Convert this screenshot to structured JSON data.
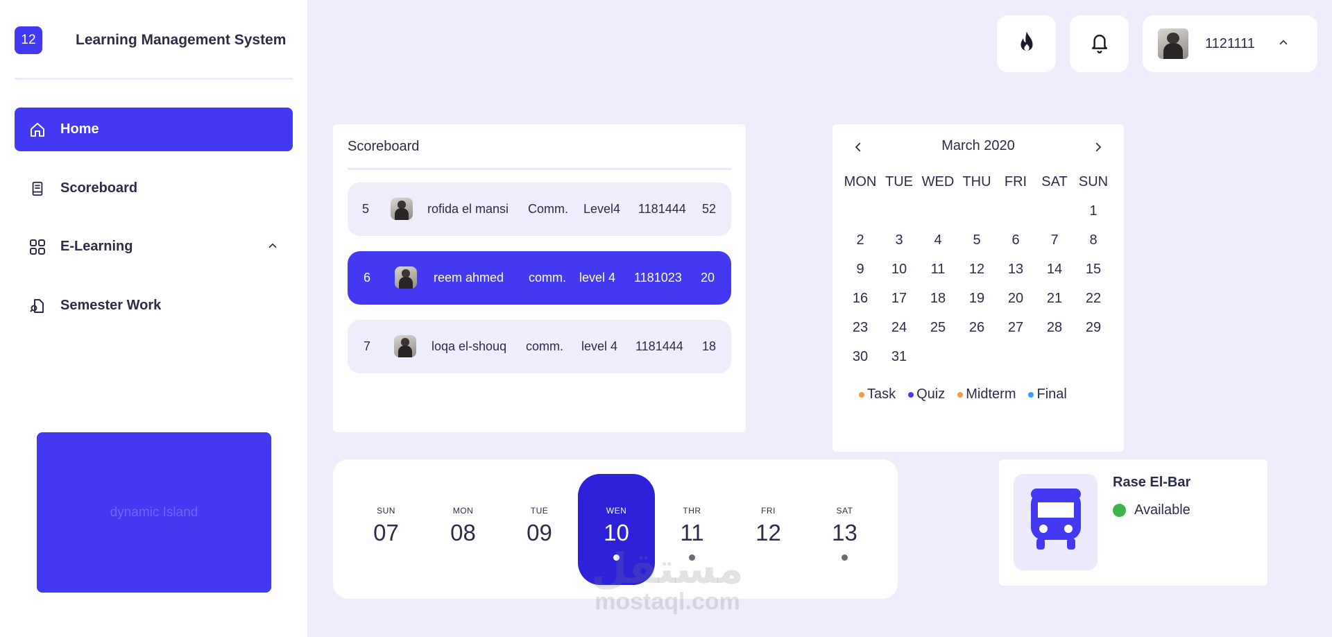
{
  "app": {
    "badge": "12",
    "title": "Learning Management System"
  },
  "sidebar": {
    "items": [
      {
        "label": "Home",
        "icon": "home-icon",
        "active": true
      },
      {
        "label": "Scoreboard",
        "icon": "book-icon",
        "active": false
      },
      {
        "label": "E-Learning",
        "icon": "grid-icon",
        "active": false,
        "expanded": true
      },
      {
        "label": "Semester Work",
        "icon": "document-icon",
        "active": false
      }
    ],
    "island_label": "dynamic Island"
  },
  "topbar": {
    "streak_icon": "flame-icon",
    "notification_icon": "bell-icon",
    "user_id": "1121111"
  },
  "scoreboard": {
    "title": "Scoreboard",
    "rows": [
      {
        "rank": "5",
        "name": "rofida el mansi",
        "dept": "Comm.",
        "level": "Level4",
        "id": "1181444",
        "score": "52",
        "active": false
      },
      {
        "rank": "6",
        "name": "reem ahmed",
        "dept": "comm.",
        "level": "level 4",
        "id": "1181023",
        "score": "20",
        "active": true
      },
      {
        "rank": "7",
        "name": "loqa el-shouq",
        "dept": "comm.",
        "level": "level 4",
        "id": "1181444",
        "score": "18",
        "active": false
      }
    ]
  },
  "calendar": {
    "month": "March 2020",
    "weekdays": [
      "MON",
      "TUE",
      "WED",
      "THU",
      "FRI",
      "SAT",
      "SUN"
    ],
    "weeks": [
      [
        "",
        "",
        "",
        "",
        "",
        "",
        "1"
      ],
      [
        "2",
        "3",
        "4",
        "5",
        "6",
        "7",
        "8"
      ],
      [
        "9",
        "10",
        "11",
        "12",
        "13",
        "14",
        "15"
      ],
      [
        "16",
        "17",
        "18",
        "19",
        "20",
        "21",
        "22"
      ],
      [
        "23",
        "24",
        "25",
        "26",
        "27",
        "28",
        "29"
      ],
      [
        "30",
        "31",
        "",
        "",
        "",
        "",
        ""
      ]
    ],
    "legend": [
      {
        "label": "Task",
        "color": "#f59a4a"
      },
      {
        "label": "Quiz",
        "color": "#4339f2"
      },
      {
        "label": "Midterm",
        "color": "#f59a4a"
      },
      {
        "label": "Final",
        "color": "#3d9cf0"
      }
    ]
  },
  "week_strip": {
    "days": [
      {
        "name": "SUN",
        "num": "07",
        "dot": false,
        "active": false
      },
      {
        "name": "MON",
        "num": "08",
        "dot": false,
        "active": false
      },
      {
        "name": "TUE",
        "num": "09",
        "dot": false,
        "active": false
      },
      {
        "name": "WEN",
        "num": "10",
        "dot": true,
        "active": true
      },
      {
        "name": "THR",
        "num": "11",
        "dot": true,
        "active": false
      },
      {
        "name": "FRI",
        "num": "12",
        "dot": false,
        "active": false
      },
      {
        "name": "SAT",
        "num": "13",
        "dot": true,
        "active": false
      }
    ]
  },
  "bus": {
    "name": "Rase El-Bar",
    "status": "Available",
    "status_color": "#3db54a",
    "icon": "bus-icon"
  },
  "watermark": {
    "arabic": "مستقل",
    "latin": "mostaql.com"
  },
  "colors": {
    "accent": "#4339f2",
    "accent_dark": "#2d22d9",
    "background": "#eeedfb",
    "text": "#2b2b4a"
  }
}
